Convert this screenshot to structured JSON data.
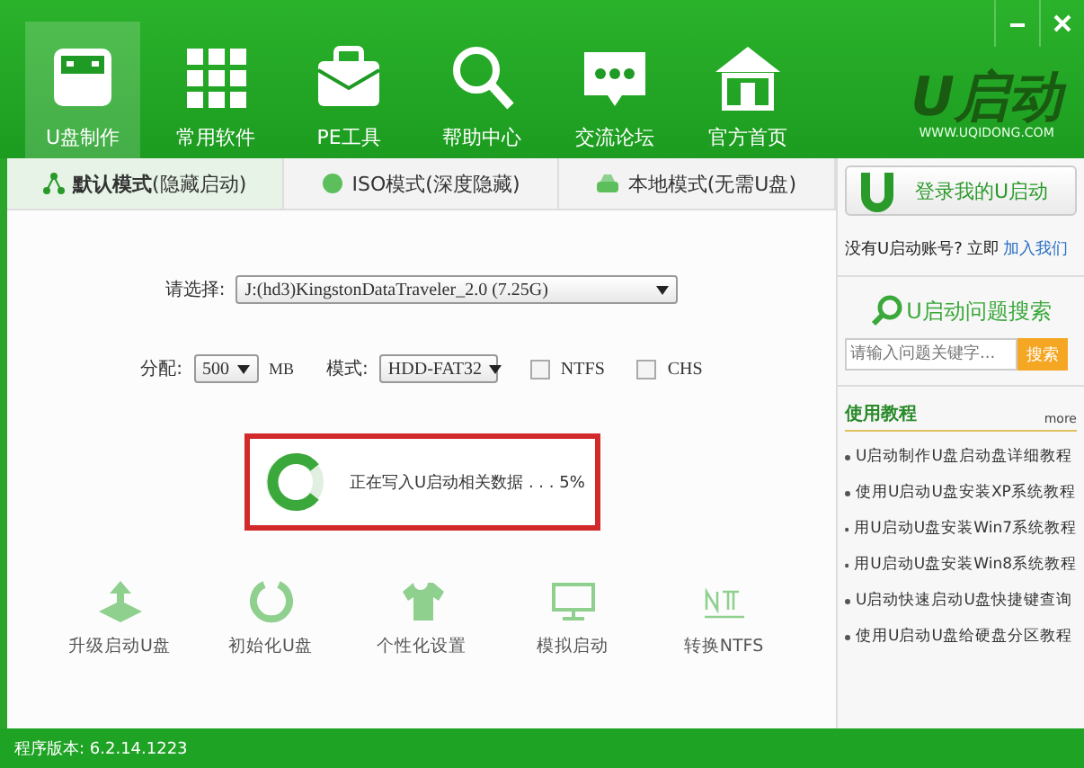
{
  "nav": [
    {
      "label": "U盘制作",
      "kind": "usb",
      "selected": true
    },
    {
      "label": "常用软件",
      "kind": "grid",
      "selected": false
    },
    {
      "label": "PE工具",
      "kind": "briefcase",
      "selected": false
    },
    {
      "label": "帮助中心",
      "kind": "search",
      "selected": false
    },
    {
      "label": "交流论坛",
      "kind": "chat",
      "selected": false
    },
    {
      "label": "官方首页",
      "kind": "home",
      "selected": false
    }
  ],
  "logo": {
    "text": "U启动",
    "url": "WWW.UQIDONG.COM"
  },
  "mode_tabs": [
    {
      "label": "默认模式",
      "note": "(隐藏启动)",
      "kind": "share",
      "selected": true
    },
    {
      "label": "ISO模式",
      "note": "(深度隐藏)",
      "kind": "disc",
      "selected": false
    },
    {
      "label": "本地模式",
      "note": "(无需U盘)",
      "kind": "drive",
      "selected": false
    }
  ],
  "device": {
    "label": "请选择:",
    "value": "J:(hd3)KingstonDataTraveler_2.0 (7.25G)"
  },
  "partition": {
    "label": "分配:",
    "value": "500",
    "unit": "MB"
  },
  "mode": {
    "label": "模式:",
    "value": "HDD-FAT32"
  },
  "options": [
    {
      "label": "NTFS",
      "checked": false
    },
    {
      "label": "CHS",
      "checked": false
    }
  ],
  "progress": {
    "text": "正在写入U启动相关数据 . . . 5%"
  },
  "tools": [
    {
      "label": "升级启动U盘",
      "kind": "upgrade"
    },
    {
      "label": "初始化U盘",
      "kind": "reset"
    },
    {
      "label": "个性化设置",
      "kind": "shirt"
    },
    {
      "label": "模拟启动",
      "kind": "monitor"
    },
    {
      "label": "转换NTFS",
      "kind": "ntfs"
    }
  ],
  "sidebar": {
    "login_button": "登录我的U启动",
    "signup_text": "没有U启动账号? 立即",
    "signup_link": "加入我们",
    "search_title": "U启动问题搜索",
    "search_placeholder": "请输入问题关键字...",
    "search_button": "搜索",
    "tutorials_title": "使用教程",
    "more": "more",
    "tutorials": [
      "U启动制作U盘启动盘详细教程",
      "使用U启动U盘安装XP系统教程",
      "用U启动U盘安装Win7系统教程",
      "用U启动U盘安装Win8系统教程",
      "U启动快速启动U盘快捷键查询",
      "使用U启动U盘给硬盘分区教程"
    ]
  },
  "status_bar": {
    "version": "程序版本: 6.2.14.1223"
  }
}
